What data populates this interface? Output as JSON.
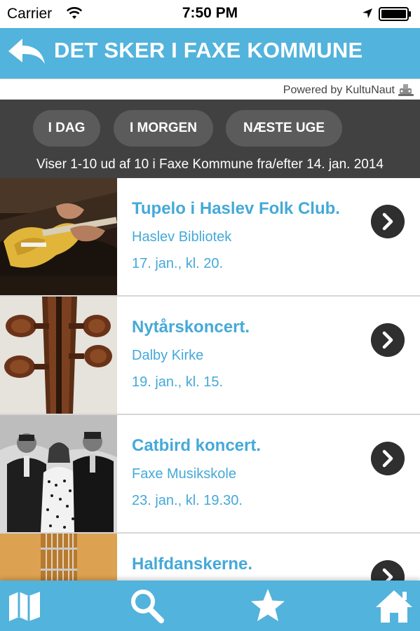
{
  "status_bar": {
    "carrier": "Carrier",
    "time": "7:50 PM"
  },
  "nav": {
    "title": "DET SKER I FAXE KOMMUNE",
    "back_icon": "back-arrow-icon"
  },
  "powered_by": "Powered by KultuNaut",
  "filters": {
    "buttons": [
      "I DAG",
      "I MORGEN",
      "NÆSTE UGE"
    ],
    "info": "Viser 1-10 ud af 10 i Faxe Kommune fra/efter 14. jan. 2014"
  },
  "events": [
    {
      "title": "Tupelo i Haslev Folk Club.",
      "venue": "Haslev Bibliotek",
      "date": "17. jan., kl. 20.",
      "image": "guitar-player-photo"
    },
    {
      "title": "Nytårskoncert.",
      "venue": "Dalby Kirke",
      "date": "19. jan., kl. 15.",
      "image": "violin-scroll-photo"
    },
    {
      "title": "Catbird koncert.",
      "venue": "Faxe Musikskole",
      "date": "23. jan., kl. 19.30.",
      "image": "band-photo"
    },
    {
      "title": "Halfdanskerne.",
      "venue": "",
      "date": "",
      "image": "acoustic-guitar-photo"
    }
  ],
  "tabs": [
    {
      "icon": "map-icon"
    },
    {
      "icon": "search-icon"
    },
    {
      "icon": "star-icon"
    },
    {
      "icon": "home-icon"
    }
  ],
  "colors": {
    "accent": "#52b3dc",
    "link_text": "#45a9d8",
    "filter_bar": "#414141",
    "filter_button": "#5b5b5b",
    "chevron": "#2f2f2f"
  }
}
